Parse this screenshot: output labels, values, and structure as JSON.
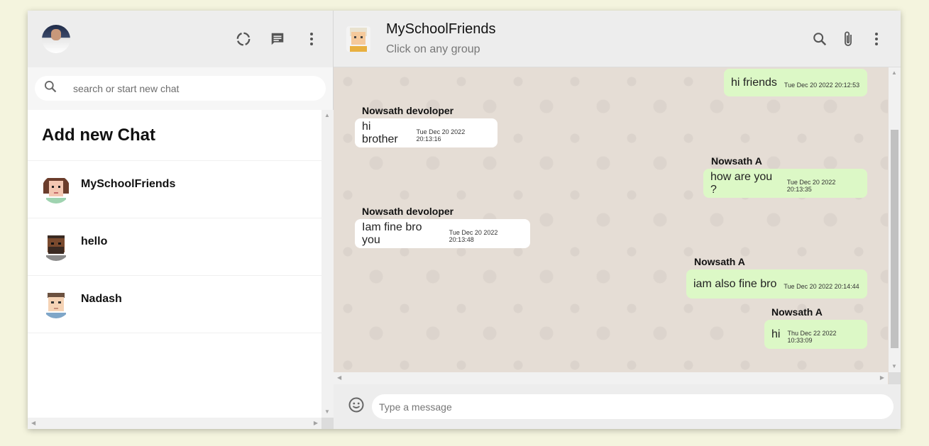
{
  "sidebar": {
    "search": {
      "placeholder": "search or start new chat",
      "value": ""
    },
    "add_chat_label": "Add new Chat",
    "chats": [
      {
        "name": "MySchoolFriends",
        "avatar": "female-pixel-avatar"
      },
      {
        "name": "hello",
        "avatar": "bearded-pixel-avatar"
      },
      {
        "name": "Nadash",
        "avatar": "male-pixel-avatar"
      }
    ],
    "icons": [
      "status-icon",
      "new-chat-icon",
      "more-options-icon"
    ]
  },
  "chat": {
    "title": "MySchoolFriends",
    "subtitle": "Click on any group",
    "icons": [
      "search-icon",
      "attach-icon",
      "more-options-icon"
    ],
    "messages": [
      {
        "direction": "out",
        "sender": "",
        "text": "hi friends",
        "time": "Tue Dec 20 2022 20:12:53"
      },
      {
        "direction": "in",
        "sender": "Nowsath devoloper",
        "text": "hi brother",
        "time": "Tue Dec 20 2022 20:13:16"
      },
      {
        "direction": "out",
        "sender": "Nowsath A",
        "text": "how are you ?",
        "time": "Tue Dec 20 2022 20:13:35"
      },
      {
        "direction": "in",
        "sender": "Nowsath devoloper",
        "text": "Iam fine bro you",
        "time": "Tue Dec 20 2022 20:13:48"
      },
      {
        "direction": "out",
        "sender": "Nowsath A",
        "text": "iam also fine bro",
        "time": "Tue Dec 20 2022 20:14:44"
      },
      {
        "direction": "out",
        "sender": "Nowsath A",
        "text": "hi",
        "time": "Thu Dec 22 2022 10:33:09"
      }
    ],
    "composer": {
      "placeholder": "Type a message",
      "value": ""
    }
  },
  "colors": {
    "page_bg": "#f4f4de",
    "header_bg": "#ededed",
    "chat_bg": "#e5ddd5",
    "outgoing_bubble": "#dcf8c6",
    "incoming_bubble": "#ffffff"
  }
}
